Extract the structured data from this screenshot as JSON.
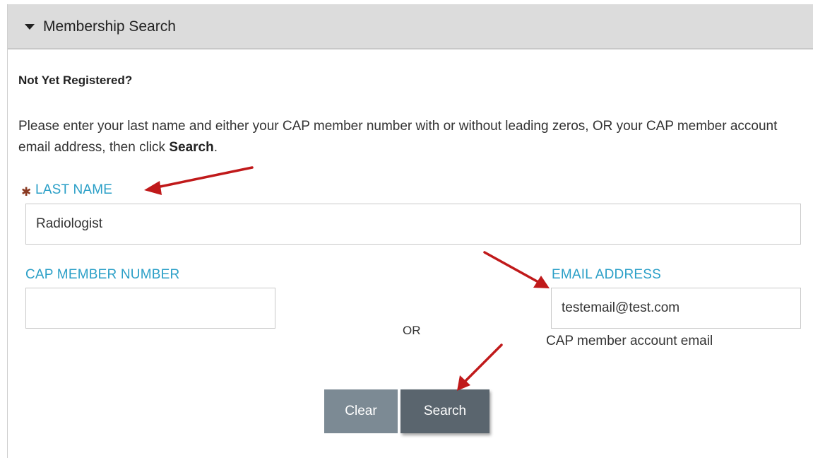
{
  "panel": {
    "title": "Membership Search",
    "icons": {
      "toggle": "caret-down-icon"
    }
  },
  "form": {
    "heading": "Not Yet Registered?",
    "instructions": {
      "before_bold": "Please enter your last name and either your CAP member number with or without leading zeros, OR your CAP member account email address, then click ",
      "bold": "Search",
      "after_bold": "."
    },
    "required_marker": "✱",
    "last_name": {
      "label": "LAST NAME",
      "value": "Radiologist"
    },
    "member_number": {
      "label": "CAP MEMBER NUMBER",
      "value": ""
    },
    "or_label": "OR",
    "email": {
      "label": "EMAIL ADDRESS",
      "value": "testemail@test.com",
      "helper": "CAP member account email"
    },
    "buttons": {
      "clear": "Clear",
      "search": "Search"
    }
  },
  "colors": {
    "label": "#2a9fc7",
    "header_bg": "#dcdcdc",
    "clear_button": "#7c8a94",
    "search_button": "#5a656e",
    "annotation_arrow": "#c0191a",
    "required_marker": "#8a3a22"
  }
}
